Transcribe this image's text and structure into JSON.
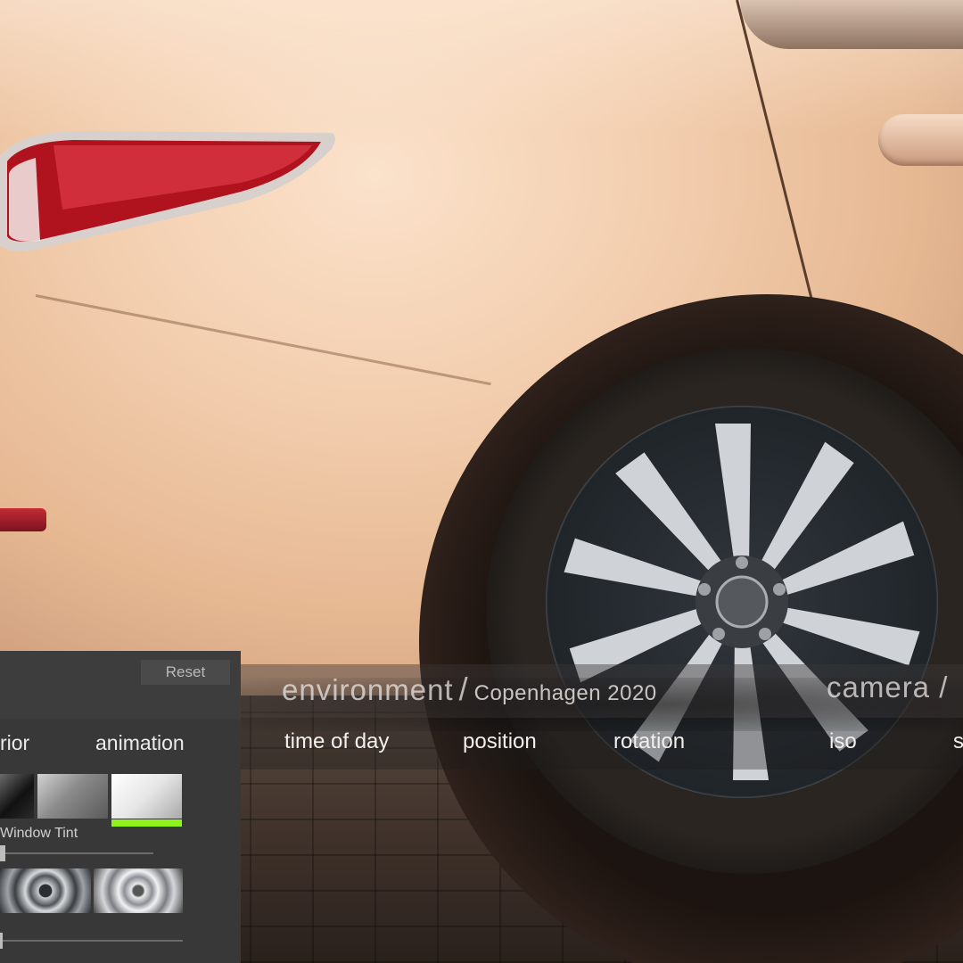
{
  "panel": {
    "reset_label": "Reset",
    "tabs": [
      {
        "label": "rior"
      },
      {
        "label": "animation"
      }
    ],
    "swatches": [
      {
        "name": "black",
        "active": false
      },
      {
        "name": "silver",
        "active": false
      },
      {
        "name": "white",
        "active": true
      }
    ],
    "window_tint_label": "Window Tint",
    "window_tint_value": 0,
    "wheel_options": [
      {
        "name": "wheel-dark-machined",
        "active": false
      },
      {
        "name": "wheel-silver",
        "active": false
      }
    ],
    "accent_color": "#8ef21b"
  },
  "environment": {
    "label": "environment",
    "separator": "/",
    "value": "Copenhagen 2020"
  },
  "camera": {
    "label": "camera /"
  },
  "subnav": {
    "items": [
      {
        "label": "time of day"
      },
      {
        "label": "position"
      },
      {
        "label": "rotation"
      },
      {
        "label": "iso"
      },
      {
        "label": "s"
      }
    ]
  }
}
